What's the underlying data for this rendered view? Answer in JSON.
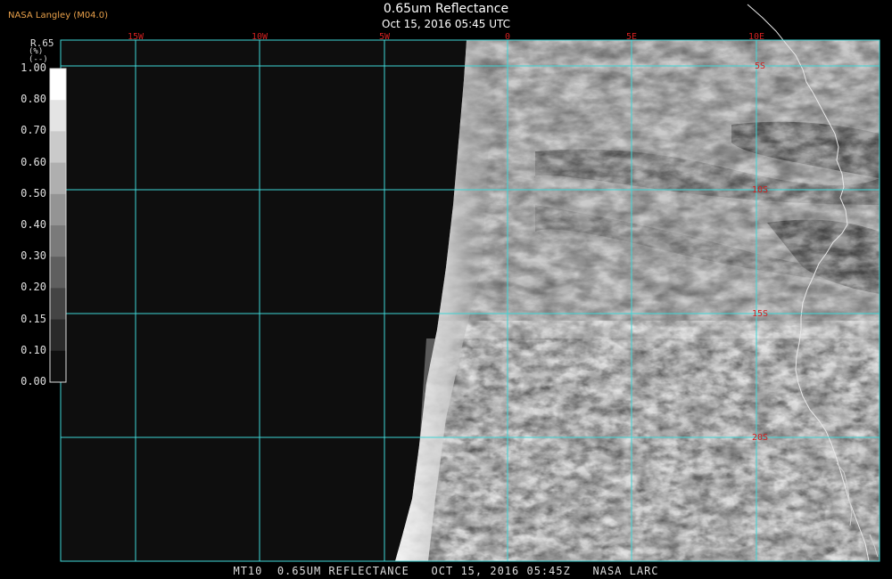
{
  "header": {
    "org": "NASA Langley (M04.0)",
    "title": "0.65um Reflectance",
    "subtitle": "Oct 15, 2016 05:45 UTC"
  },
  "colorbar": {
    "title": "R.65",
    "unit_top": "(%)",
    "unit_bottom": "(--)",
    "ticks": [
      "1.00",
      "0.80",
      "0.70",
      "0.60",
      "0.50",
      "0.40",
      "0.30",
      "0.20",
      "0.15",
      "0.10",
      "0.00"
    ]
  },
  "map": {
    "lon_labels": [
      "15W",
      "10W",
      "5W",
      "0",
      "5E",
      "10E"
    ],
    "lat_labels": [
      "5S",
      "10S",
      "15S",
      "20S"
    ],
    "grid_color": "#3fd6d6",
    "label_color": "#d22020",
    "coast_color": "#e8e8e8"
  },
  "footer": {
    "text": "MT10  0.65UM REFLECTANCE   OCT 15, 2016 05:45Z   NASA LARC"
  }
}
